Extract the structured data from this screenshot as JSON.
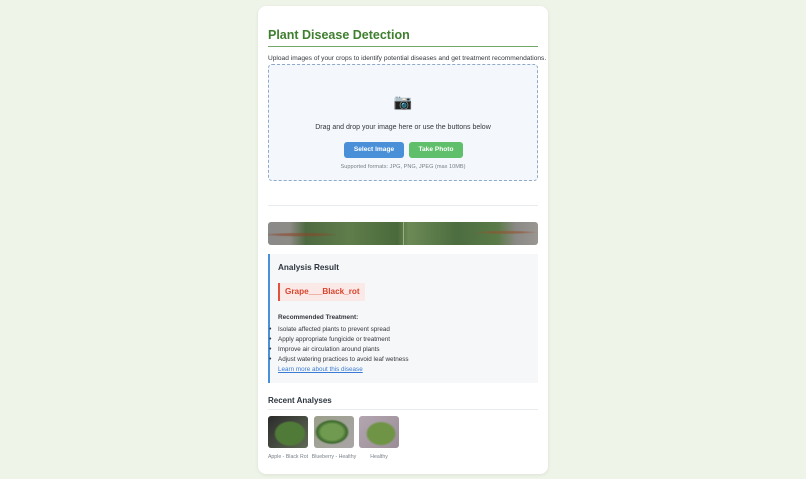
{
  "app": {
    "title": "Plant Disease Detection",
    "intro": "Upload images of your crops to identify potential diseases and get treatment recommendations."
  },
  "upload": {
    "icon": "camera-icon",
    "prompt": "Drag and drop your image here or use the buttons below",
    "select_label": "Select Image",
    "photo_label": "Take Photo",
    "formats": "Supported formats: JPG, PNG, JPEG (max 10MB)"
  },
  "result": {
    "heading": "Analysis Result",
    "disease": "Grape___Black_rot",
    "treatment_heading": "Recommended Treatment:",
    "treatments": [
      "Isolate affected plants to prevent spread",
      "Apply appropriate fungicide or treatment",
      "Improve air circulation around plants",
      "Adjust watering practices to avoid leaf wetness"
    ],
    "learn_more": "Learn more about this disease"
  },
  "recent": {
    "heading": "Recent Analyses",
    "items": [
      {
        "caption": "Apple - Black Rot"
      },
      {
        "caption": "Blueberry - Healthy"
      },
      {
        "caption": "Healthy"
      }
    ]
  },
  "colors": {
    "brand_green": "#3f7f2f",
    "accent_blue": "#4a90d9",
    "photo_green": "#5fbf6a",
    "alert_red": "#d8442c"
  }
}
